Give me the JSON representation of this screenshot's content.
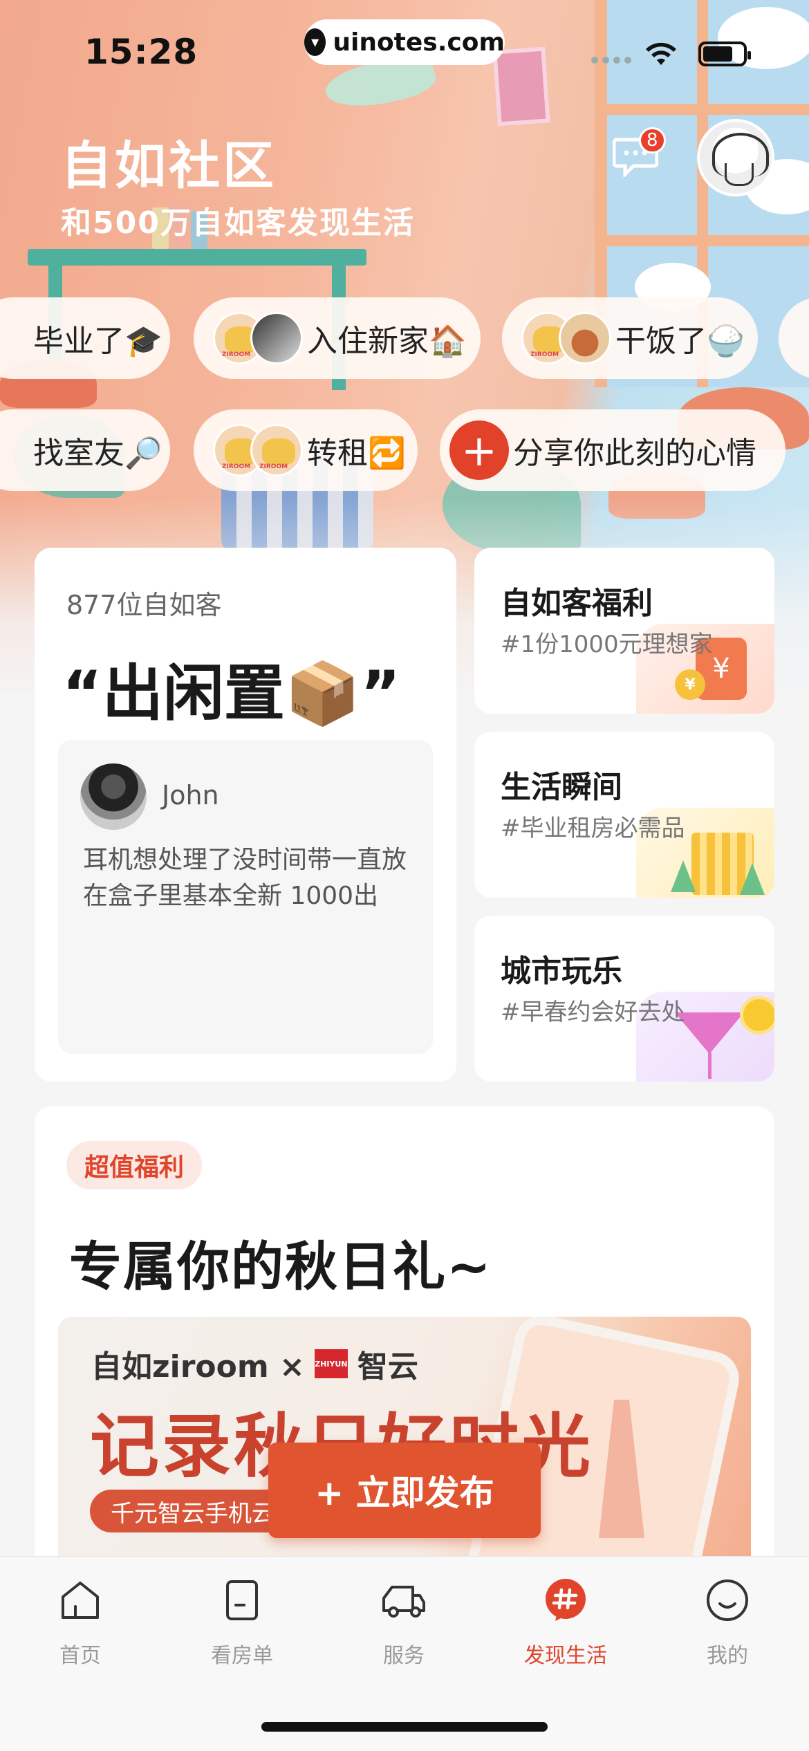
{
  "status_bar": {
    "time": "15:28",
    "url": "uinotes.com"
  },
  "header": {
    "title": "自如社区",
    "subtitle": "和500万自如客发现生活",
    "message_badge": "8"
  },
  "topics_row1": [
    {
      "label": "毕业了🎓"
    },
    {
      "label": "入住新家🏠"
    },
    {
      "label": "干饭了🍚"
    }
  ],
  "topics_row2": [
    {
      "label": "找室友🔎"
    },
    {
      "label": "转租🔁"
    },
    {
      "label": "分享你此刻的心情"
    }
  ],
  "featured": {
    "count": "877位自如客",
    "topic": "“出闲置📦”",
    "post": {
      "user": "John",
      "text": "耳机想处理了没时间带一直放在盒子里基本全新 1000出"
    }
  },
  "side_cards": [
    {
      "title": "自如客福利",
      "subtitle": "#1份1000元理想家"
    },
    {
      "title": "生活瞬间",
      "subtitle": "#毕业租房必需品"
    },
    {
      "title": "城市玩乐",
      "subtitle": "#早春约会好去处"
    }
  ],
  "benefit": {
    "tag": "超值福利",
    "title": "专属你的秋日礼~",
    "banner": {
      "brand": "自如ziroom × ",
      "brand2": "智云",
      "brand2_logo": "ZHIYUN",
      "headline": "记录秋日好时光",
      "sub": "千元智云手机云台"
    }
  },
  "publish_button": {
    "label": "+ 立即发布"
  },
  "tabs": [
    {
      "label": "首页",
      "icon": "home-icon"
    },
    {
      "label": "看房单",
      "icon": "document-icon"
    },
    {
      "label": "服务",
      "icon": "truck-icon"
    },
    {
      "label": "发现生活",
      "icon": "hashtag-icon",
      "active": true
    },
    {
      "label": "我的",
      "icon": "smiley-icon"
    }
  ],
  "colors": {
    "accent": "#e0452c",
    "badge": "#e8402c"
  }
}
